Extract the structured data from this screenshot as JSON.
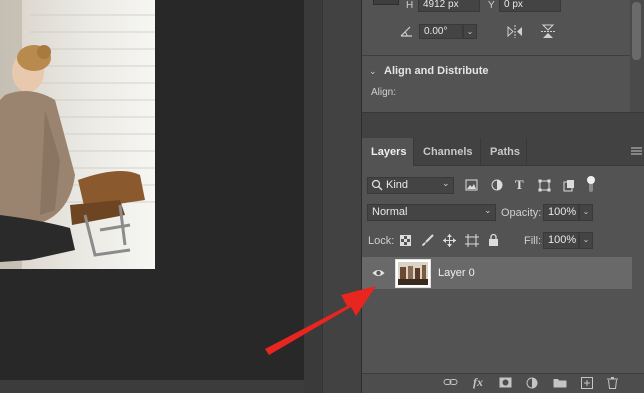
{
  "properties": {
    "h_label": "H",
    "h_value": "4912 px",
    "y_label": "Y",
    "y_value": "0 px",
    "angle_value": "0.00°",
    "align_section_title": "Align and Distribute",
    "align_label": "Align:"
  },
  "layers_panel": {
    "tabs": [
      {
        "label": "Layers",
        "active": true
      },
      {
        "label": "Channels",
        "active": false
      },
      {
        "label": "Paths",
        "active": false
      }
    ],
    "filter_kind": "Kind",
    "blend_mode": "Normal",
    "opacity_label": "Opacity:",
    "opacity_value": "100%",
    "lock_label": "Lock:",
    "fill_label": "Fill:",
    "fill_value": "100%",
    "layers": [
      {
        "name": "Layer 0",
        "visible": true,
        "selected": true
      }
    ],
    "footer_icons": [
      "link-icon",
      "fx-icon",
      "mask-icon",
      "adjustment-icon",
      "group-icon",
      "new-layer-icon",
      "trash-icon"
    ]
  },
  "annotation": {
    "arrow_color": "#e8251f"
  }
}
